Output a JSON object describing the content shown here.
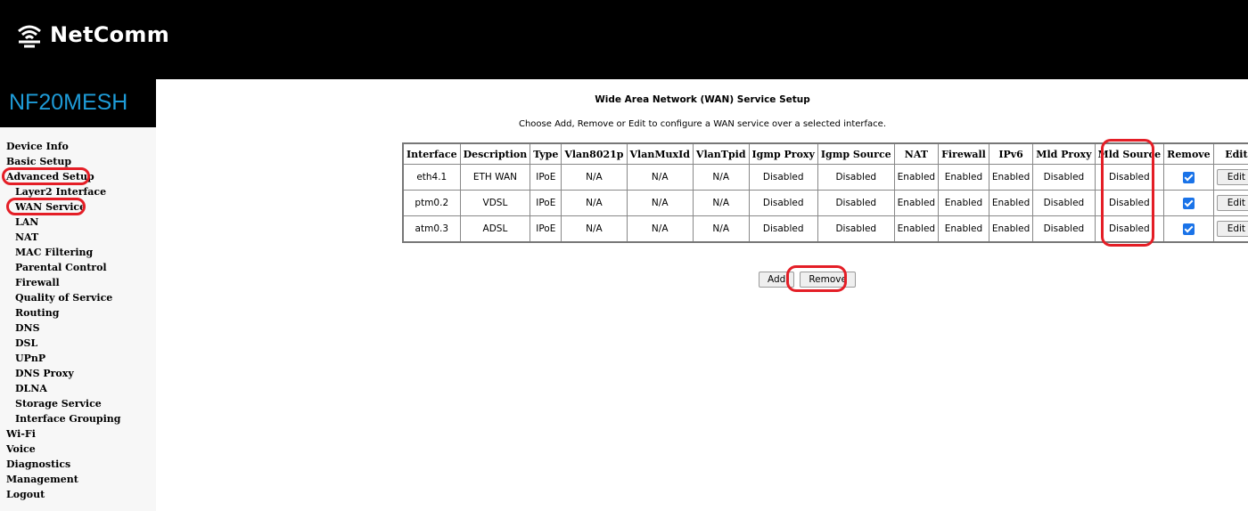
{
  "brand": {
    "name": "NetComm",
    "model": "NF20MESH"
  },
  "nav": [
    {
      "label": "Device Info",
      "sub": false
    },
    {
      "label": "Basic Setup",
      "sub": false
    },
    {
      "label": "Advanced Setup",
      "sub": false
    },
    {
      "label": "Layer2 Interface",
      "sub": true
    },
    {
      "label": "WAN Service",
      "sub": true
    },
    {
      "label": "LAN",
      "sub": true
    },
    {
      "label": "NAT",
      "sub": true
    },
    {
      "label": "MAC Filtering",
      "sub": true
    },
    {
      "label": "Parental Control",
      "sub": true
    },
    {
      "label": "Firewall",
      "sub": true
    },
    {
      "label": "Quality of Service",
      "sub": true
    },
    {
      "label": "Routing",
      "sub": true
    },
    {
      "label": "DNS",
      "sub": true
    },
    {
      "label": "DSL",
      "sub": true
    },
    {
      "label": "UPnP",
      "sub": true
    },
    {
      "label": "DNS Proxy",
      "sub": true
    },
    {
      "label": "DLNA",
      "sub": true
    },
    {
      "label": "Storage Service",
      "sub": true
    },
    {
      "label": "Interface Grouping",
      "sub": true
    },
    {
      "label": "Wi-Fi",
      "sub": false
    },
    {
      "label": "Voice",
      "sub": false
    },
    {
      "label": "Diagnostics",
      "sub": false
    },
    {
      "label": "Management",
      "sub": false
    },
    {
      "label": "Logout",
      "sub": false
    }
  ],
  "main": {
    "title": "Wide Area Network (WAN) Service Setup",
    "subtitle": "Choose Add, Remove or Edit to configure a WAN service over a selected interface.",
    "add_label": "Add",
    "remove_label": "Remove"
  },
  "table": {
    "headers": [
      "Interface",
      "Description",
      "Type",
      "Vlan8021p",
      "VlanMuxId",
      "VlanTpid",
      "Igmp Proxy",
      "Igmp Source",
      "NAT",
      "Firewall",
      "IPv6",
      "Mld Proxy",
      "Mld Source",
      "Remove",
      "Edit"
    ],
    "rows": [
      {
        "cells": [
          "eth4.1",
          "ETH WAN",
          "IPoE",
          "N/A",
          "N/A",
          "N/A",
          "Disabled",
          "Disabled",
          "Enabled",
          "Enabled",
          "Enabled",
          "Disabled",
          "Disabled"
        ],
        "remove_checked": true,
        "edit_label": "Edit"
      },
      {
        "cells": [
          "ptm0.2",
          "VDSL",
          "IPoE",
          "N/A",
          "N/A",
          "N/A",
          "Disabled",
          "Disabled",
          "Enabled",
          "Enabled",
          "Enabled",
          "Disabled",
          "Disabled"
        ],
        "remove_checked": true,
        "edit_label": "Edit"
      },
      {
        "cells": [
          "atm0.3",
          "ADSL",
          "IPoE",
          "N/A",
          "N/A",
          "N/A",
          "Disabled",
          "Disabled",
          "Enabled",
          "Enabled",
          "Enabled",
          "Disabled",
          "Disabled"
        ],
        "remove_checked": true,
        "edit_label": "Edit"
      }
    ]
  },
  "colors": {
    "header_bg": "#000000",
    "model_text": "#1e9bd7",
    "highlight": "#e41e26",
    "checkbox": "#1a73e8"
  }
}
